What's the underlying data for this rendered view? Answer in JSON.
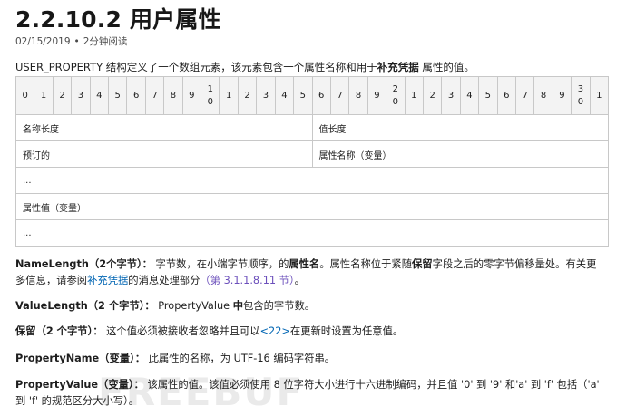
{
  "header": {
    "title": "2.2.10.2 用户属性",
    "date": "02/15/2019",
    "separator": "•",
    "read_time": "2分钟阅读"
  },
  "intro": {
    "before": "USER_PROPERTY 结构定义了一个数组元素，该元素包含一个属性名称和用于",
    "bold": "补充凭据",
    "after": " 属性的值。"
  },
  "bit_header": [
    "0",
    "1",
    "2",
    "3",
    "4",
    "5",
    "6",
    "7",
    "8",
    "9",
    "1\n0",
    "1",
    "2",
    "3",
    "4",
    "5",
    "6",
    "7",
    "8",
    "9",
    "2\n0",
    "1",
    "2",
    "3",
    "4",
    "5",
    "6",
    "7",
    "8",
    "9",
    "3\n0",
    "1"
  ],
  "table_rows": [
    {
      "left": "名称长度",
      "right": "值长度"
    },
    {
      "left": "预订的",
      "right": "属性名称（变量）"
    },
    {
      "full": "..."
    },
    {
      "full": "属性值（变量）"
    },
    {
      "full": "..."
    }
  ],
  "fields": {
    "namelength": {
      "term": "NameLength（2个字节）：",
      "text1": "字节数，在小端字节顺序，的",
      "bold1": "属性名",
      "text2": "。属性名称位于紧随",
      "bold2": "保留",
      "text3": "字段之后的零字节偏移量处。有关更多信息，请参阅",
      "link1": "补充凭据",
      "text4": "的消息处理部分",
      "link2": "（第 3.1.1.8.11 节）",
      "text5": "。"
    },
    "valuelength": {
      "term": "ValueLength（2 个字节）：",
      "text1": "PropertyValue ",
      "bold1": "中",
      "text2": "包含的字节数。"
    },
    "reserved": {
      "term": "保留（2 个字节）：",
      "text1": "这个值必须被接收者忽略并且可以",
      "link1": "<22>",
      "text2": "在更新时设置为任意值。"
    },
    "propertyname": {
      "term": "PropertyName（变量）：",
      "text1": "此属性的名称，为 UTF-16 编码字符串。"
    },
    "propertyvalue": {
      "term": "PropertyValue（变量）：",
      "text1": "该属性的值。该值必须使用 8 位字符大小进行十六进制编码，并且值 '0' 到 '9' 和'a' 到 'f' 包括（'a' 到 'f' 的规范区分大小写）。"
    }
  },
  "watermark": "FREEBUF"
}
